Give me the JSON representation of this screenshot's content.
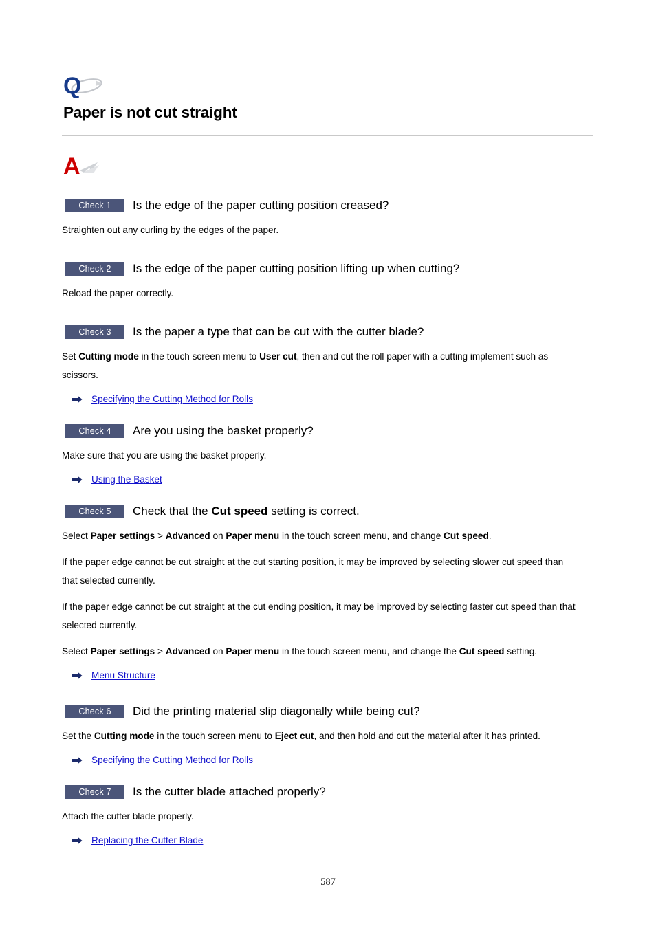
{
  "document": {
    "question_icon": "Q",
    "answer_icon": "A",
    "title": "Paper is not cut straight",
    "page_number": "587"
  },
  "colors": {
    "badge_background": "#4b5579",
    "badge_text": "#ffffff",
    "question_icon": "#173a8a",
    "answer_icon": "#cc0000",
    "link": "#1111cc",
    "arrow": "#1b2a6b",
    "rule": "#c9c9c9",
    "text": "#000000"
  },
  "checks": [
    {
      "badge": "Check 1",
      "question_parts": [
        {
          "text": "Is the edge of the paper cutting position creased?",
          "bold": false
        }
      ],
      "paragraphs": [
        [
          {
            "text": "Straighten out any curling by the edges of the paper.",
            "bold": false
          }
        ]
      ],
      "links": []
    },
    {
      "badge": "Check 2",
      "question_parts": [
        {
          "text": "Is the edge of the paper cutting position lifting up when cutting?",
          "bold": false
        }
      ],
      "paragraphs": [
        [
          {
            "text": "Reload the paper correctly.",
            "bold": false
          }
        ]
      ],
      "links": []
    },
    {
      "badge": "Check 3",
      "question_parts": [
        {
          "text": "Is the paper a type that can be cut with the cutter blade?",
          "bold": false
        }
      ],
      "paragraphs": [
        [
          {
            "text": "Set ",
            "bold": false
          },
          {
            "text": "Cutting mode",
            "bold": true
          },
          {
            "text": " in the touch screen menu to ",
            "bold": false
          },
          {
            "text": "User cut",
            "bold": true
          },
          {
            "text": ", then and cut the roll paper with a cutting implement such as scissors.",
            "bold": false
          }
        ]
      ],
      "links": [
        {
          "label": "Specifying the Cutting Method for Rolls"
        }
      ]
    },
    {
      "badge": "Check 4",
      "question_parts": [
        {
          "text": "Are you using the basket properly?",
          "bold": false
        }
      ],
      "paragraphs": [
        [
          {
            "text": "Make sure that you are using the basket properly.",
            "bold": false
          }
        ]
      ],
      "links": [
        {
          "label": "Using the Basket"
        }
      ]
    },
    {
      "badge": "Check 5",
      "question_parts": [
        {
          "text": "Check that the ",
          "bold": false
        },
        {
          "text": "Cut speed",
          "bold": true
        },
        {
          "text": " setting is correct.",
          "bold": false
        }
      ],
      "paragraphs": [
        [
          {
            "text": "Select ",
            "bold": false
          },
          {
            "text": "Paper settings",
            "bold": true
          },
          {
            "text": " > ",
            "bold": false
          },
          {
            "text": "Advanced",
            "bold": true
          },
          {
            "text": " on ",
            "bold": false
          },
          {
            "text": "Paper menu",
            "bold": true
          },
          {
            "text": " in the touch screen menu, and change ",
            "bold": false
          },
          {
            "text": "Cut speed",
            "bold": true
          },
          {
            "text": ".",
            "bold": false
          }
        ],
        [
          {
            "text": "If the paper edge cannot be cut straight at the cut starting position, it may be improved by selecting slower cut speed than that selected currently.",
            "bold": false
          }
        ],
        [
          {
            "text": "If the paper edge cannot be cut straight at the cut ending position, it may be improved by selecting faster cut speed than that selected currently.",
            "bold": false
          }
        ],
        [
          {
            "text": "Select ",
            "bold": false
          },
          {
            "text": "Paper settings",
            "bold": true
          },
          {
            "text": " > ",
            "bold": false
          },
          {
            "text": "Advanced",
            "bold": true
          },
          {
            "text": " on ",
            "bold": false
          },
          {
            "text": "Paper menu",
            "bold": true
          },
          {
            "text": " in the touch screen menu, and change the ",
            "bold": false
          },
          {
            "text": "Cut speed",
            "bold": true
          },
          {
            "text": " setting.",
            "bold": false
          }
        ]
      ],
      "links": [
        {
          "label": "Menu Structure"
        }
      ]
    },
    {
      "badge": "Check 6",
      "question_parts": [
        {
          "text": "Did the printing material slip diagonally while being cut?",
          "bold": false
        }
      ],
      "paragraphs": [
        [
          {
            "text": "Set the ",
            "bold": false
          },
          {
            "text": "Cutting mode",
            "bold": true
          },
          {
            "text": " in the touch screen menu to ",
            "bold": false
          },
          {
            "text": "Eject cut",
            "bold": true
          },
          {
            "text": ", and then hold and cut the material after it has printed.",
            "bold": false
          }
        ]
      ],
      "links": [
        {
          "label": "Specifying the Cutting Method for Rolls"
        }
      ]
    },
    {
      "badge": "Check 7",
      "question_parts": [
        {
          "text": "Is the cutter blade attached properly?",
          "bold": false
        }
      ],
      "paragraphs": [
        [
          {
            "text": "Attach the cutter blade properly.",
            "bold": false
          }
        ]
      ],
      "links": [
        {
          "label": "Replacing the Cutter Blade"
        }
      ]
    }
  ]
}
